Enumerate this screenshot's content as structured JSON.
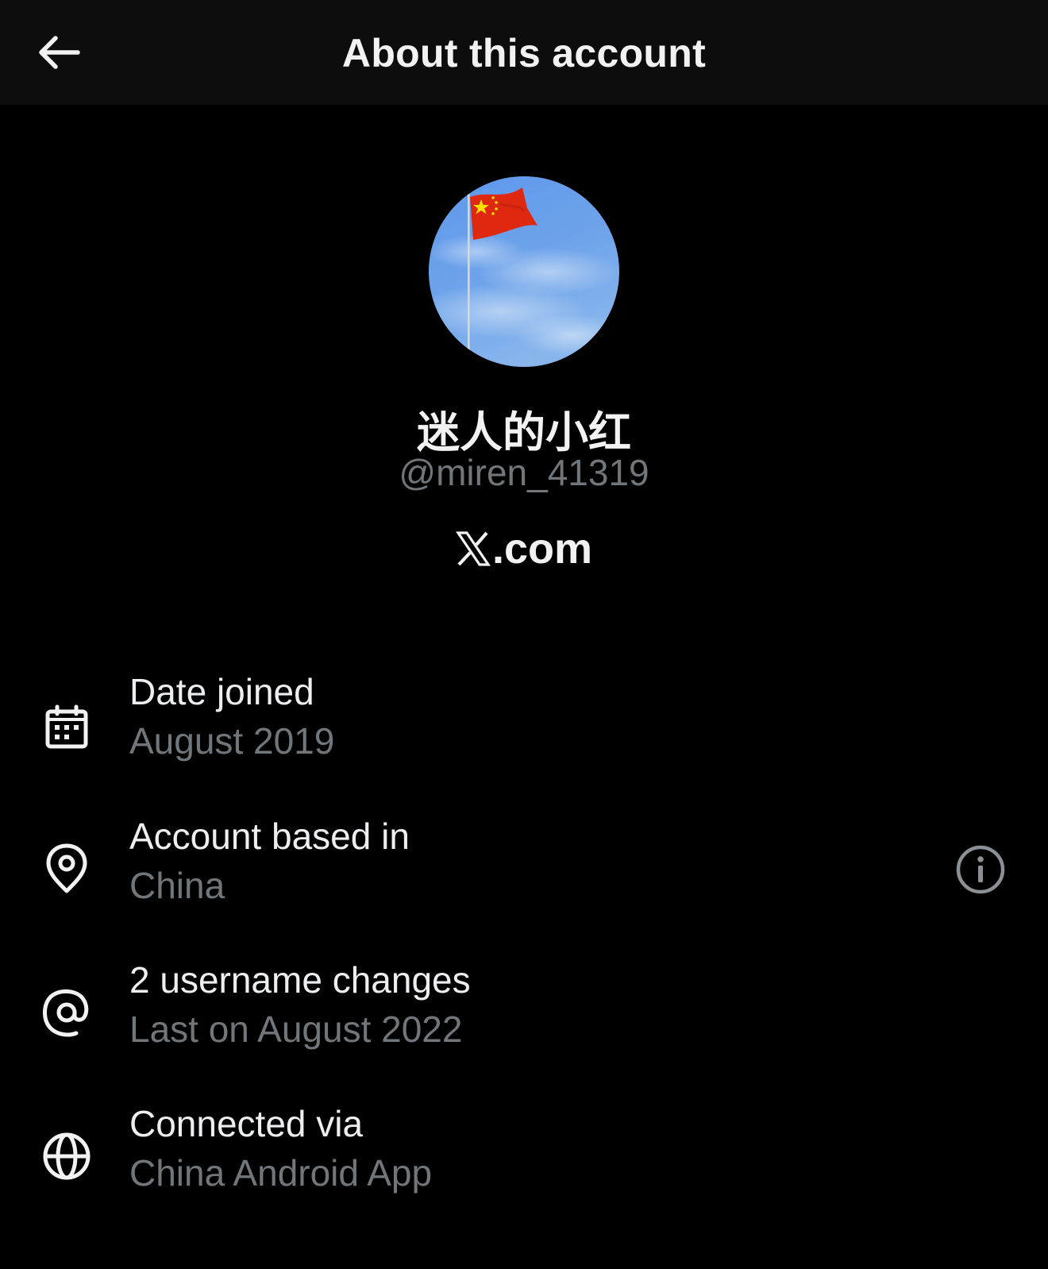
{
  "header": {
    "title": "About this account",
    "back_icon": "arrow-left-icon"
  },
  "profile": {
    "display_name": "迷人的小红",
    "handle": "@miren_41319",
    "site_suffix": ".com",
    "site_logo": "x-logo-icon",
    "avatar_description_colors": {
      "sky": "#5f97e8",
      "flag": "#de2910",
      "star": "#ffde00"
    }
  },
  "details": [
    {
      "icon": "calendar-icon",
      "title": "Date joined",
      "value": "August 2019"
    },
    {
      "icon": "location-pin-icon",
      "title": "Account based in",
      "value": "China",
      "info_icon": "info-icon"
    },
    {
      "icon": "at-sign-icon",
      "title": "2 username changes",
      "value": "Last on August 2022"
    },
    {
      "icon": "globe-icon",
      "title": "Connected via",
      "value": "China Android App"
    }
  ],
  "colors": {
    "background": "#000000",
    "header_background": "#0d0d0d",
    "primary_text": "#e7e9ea",
    "secondary_text": "#71767b"
  }
}
